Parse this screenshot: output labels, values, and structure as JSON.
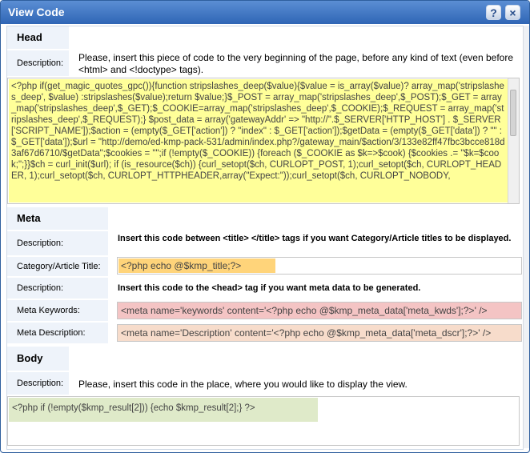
{
  "window": {
    "title": "View Code",
    "help_glyph": "?",
    "close_glyph": "×"
  },
  "head": {
    "heading": "Head",
    "description_label": "Description:",
    "description": "Please, insert this piece of code to the very beginning of the page, before any kind of text (even before <html> and <!doctype> tags).",
    "code": "<?php if(get_magic_quotes_gpc()){function stripslashes_deep($value){$value = is_array($value)? array_map('stripslashes_deep', $value) :stripslashes($value);return $value;}$_POST = array_map('stripslashes_deep',$_POST);$_GET = array_map('stripslashes_deep',$_GET);$_COOKIE=array_map('stripslashes_deep',$_COOKIE);$_REQUEST = array_map('stripslashes_deep',$_REQUEST);} $post_data = array('gatewayAddr' => \"http://\".$_SERVER['HTTP_HOST'] . $_SERVER['SCRIPT_NAME']);$action = (empty($_GET['action']) ? \"index\" : $_GET['action']);$getData = (empty($_GET['data']) ? \"\" : $_GET['data']);$url = \"http://demo/ed-kmp-pack-531/admin/index.php?/gateway_main/$action/3/133e82ff47fbc3bcce818d3af67d6710/$getData\";$cookies = \"\";if (!empty($_COOKIE)) {foreach ($_COOKIE as $k=>$cook) {$cookies .= \"$k=$cook;\";}}$ch = curl_init($url); if (is_resource($ch)) {curl_setopt($ch, CURLOPT_POST, 1);curl_setopt($ch, CURLOPT_HEADER, 1);curl_setopt($ch, CURLOPT_HTTPHEADER,array(\"Expect:\"));curl_setopt($ch, CURLOPT_NOBODY,"
  },
  "meta": {
    "heading": "Meta",
    "description_label": "Description:",
    "description1": "Insert this code between <title> </title> tags if you want Category/Article titles to be displayed.",
    "title_label": "Category/Article Title:",
    "title_code": "<?php echo @$kmp_title;?>",
    "description_label2": "Description:",
    "description2": "Insert this code to the <head> tag if you want meta data to be generated.",
    "keywords_label": "Meta Keywords:",
    "keywords_code": "<meta name='keywords' content='<?php echo @$kmp_meta_data['meta_kwds'];?>' />",
    "metadesc_label": "Meta Description:",
    "metadesc_code": "<meta name='Description' content='<?php echo @$kmp_meta_data['meta_dscr'];?>' />"
  },
  "body": {
    "heading": "Body",
    "description_label": "Description:",
    "description": "Please, insert this code in the place, where you would like to display the view.",
    "code": "<?php if (!empty($kmp_result[2])) {echo $kmp_result[2];} ?>"
  },
  "colors": {
    "titlebar": "#3a6fbd",
    "head_highlight": "#ffff99",
    "title_highlight": "#ffd47a",
    "keywords_highlight": "#f4c4c4",
    "metadesc_highlight": "#f7dccb",
    "body_highlight": "#dfeac9",
    "section_bg": "#eef3fa"
  }
}
